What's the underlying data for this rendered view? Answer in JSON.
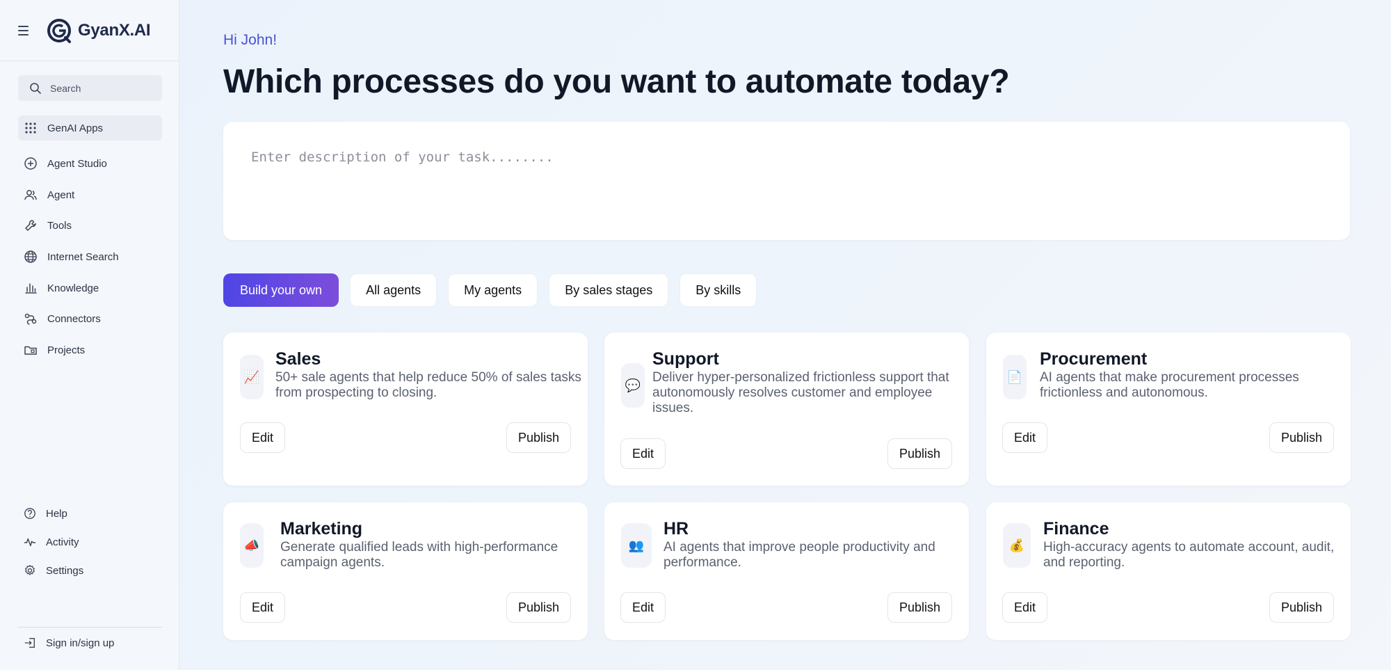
{
  "app": {
    "brand": "GyanX.AI"
  },
  "sidebar": {
    "search_label": "Search",
    "items": [
      {
        "label": "GenAI Apps",
        "icon": "grid-icon"
      },
      {
        "label": "Agent Studio",
        "icon": "plus-circle-icon"
      },
      {
        "label": "Agent",
        "icon": "users-icon"
      },
      {
        "label": "Tools",
        "icon": "wrench-icon"
      },
      {
        "label": "Internet Search",
        "icon": "globe-icon"
      },
      {
        "label": "Knowledge",
        "icon": "bar-chart-icon"
      },
      {
        "label": "Connectors",
        "icon": "connectors-icon"
      },
      {
        "label": "Projects",
        "icon": "folder-icon"
      }
    ],
    "bottom_items": [
      {
        "label": "Help",
        "icon": "help-icon"
      },
      {
        "label": "Activity",
        "icon": "activity-icon"
      },
      {
        "label": "Settings",
        "icon": "gear-icon"
      }
    ],
    "signin_label": "Sign in/sign up"
  },
  "main": {
    "greeting": "Hi John!",
    "headline": "Which processes do you want to automate today?",
    "task_placeholder": "Enter description of your task........",
    "filters": [
      "Build your own",
      "All agents",
      "My agents",
      "By sales stages",
      "By skills"
    ],
    "cards": [
      {
        "title": "Sales",
        "icon": "📈",
        "description": "50+ sale agents that help reduce 50% of sales tasks from prospecting to closing.",
        "edit": "Edit",
        "publish": "Publish"
      },
      {
        "title": "Support",
        "icon": "💬",
        "description": "Deliver hyper-personalized frictionless support that autonomously resolves customer and employee issues.",
        "edit": "Edit",
        "publish": "Publish"
      },
      {
        "title": "Procurement",
        "icon": "📄",
        "description": "AI agents that make procurement processes frictionless and autonomous.",
        "edit": "Edit",
        "publish": "Publish"
      },
      {
        "title": "Marketing",
        "icon": "📣",
        "description": "Generate qualified leads with high-performance campaign agents.",
        "edit": "Edit",
        "publish": "Publish"
      },
      {
        "title": "HR",
        "icon": "👥",
        "description": "AI agents that improve people productivity and performance.",
        "edit": "Edit",
        "publish": "Publish"
      },
      {
        "title": "Finance",
        "icon": "💰",
        "description": "High-accuracy agents to automate account, audit, and reporting.",
        "edit": "Edit",
        "publish": "Publish"
      }
    ]
  },
  "colors": {
    "accent": "#4f46e5",
    "greeting": "#4a52d6"
  }
}
